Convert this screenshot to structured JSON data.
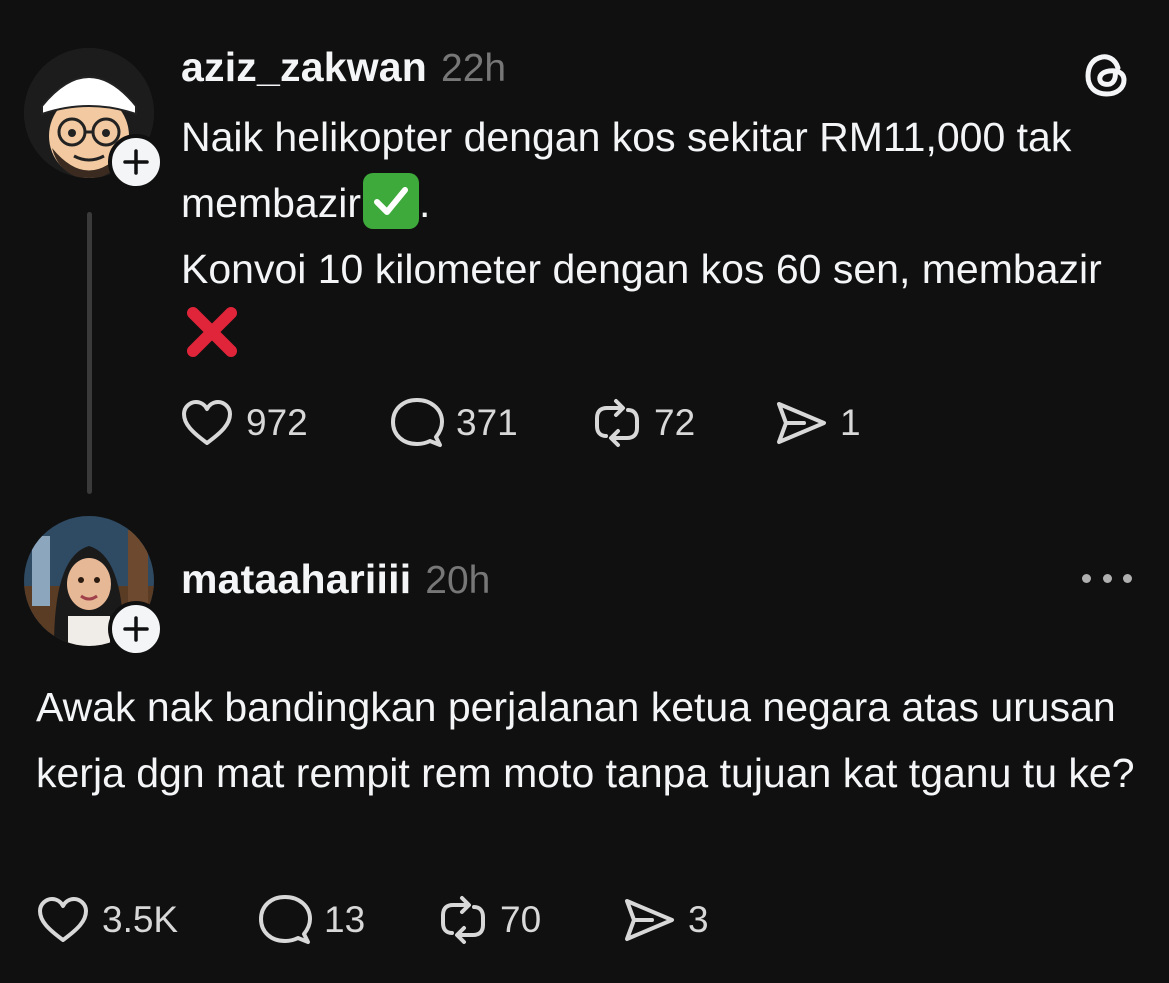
{
  "posts": [
    {
      "username": "aziz_zakwan",
      "time": "22h",
      "body_line1": "Naik helikopter dengan kos sekitar RM11,000 tak membazir",
      "body_line1_end": ".",
      "body_line2": "Konvoi 10 kilometer dengan kos 60 sen, membazir",
      "likes": "972",
      "replies": "371",
      "reposts": "72",
      "shares": "1"
    },
    {
      "username": "mataahariiii",
      "time": "20h",
      "body": "Awak nak bandingkan perjalanan ketua negara atas urusan kerja dgn mat rempit rem moto tanpa tujuan kat tganu tu ke?",
      "likes": "3.5K",
      "replies": "13",
      "reposts": "70",
      "shares": "3"
    }
  ],
  "icons": {
    "logo": "threads-logo-icon",
    "like": "heart-icon",
    "reply": "speech-bubble-icon",
    "repost": "repost-arrows-icon",
    "share": "send-icon",
    "more": "more-dots-icon",
    "follow": "plus-icon"
  },
  "colors": {
    "background": "#101010",
    "text": "#f3f5f7",
    "muted": "#777777",
    "thread_line": "#3a3a3a",
    "check_emoji": "#3eaa3b",
    "cross_emoji": "#e0253a"
  }
}
